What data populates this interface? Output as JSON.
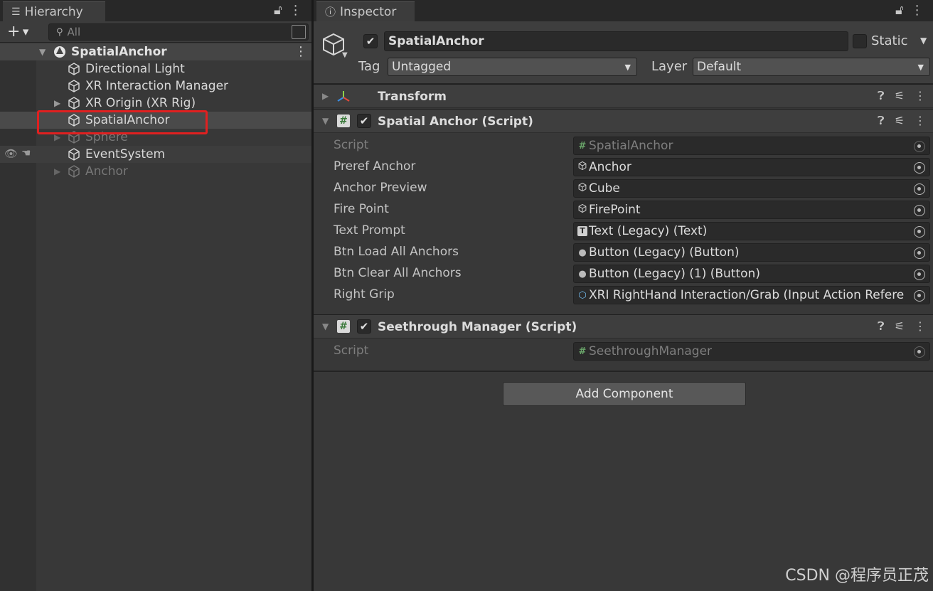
{
  "hierarchy": {
    "tab_label": "Hierarchy",
    "search_placeholder": "All",
    "scene": "SpatialAnchor",
    "items": [
      {
        "label": "Directional Light",
        "dim": false,
        "arrow": false
      },
      {
        "label": "XR Interaction Manager",
        "dim": false,
        "arrow": false
      },
      {
        "label": "XR Origin (XR Rig)",
        "dim": false,
        "arrow": true
      },
      {
        "label": "SpatialAnchor",
        "dim": false,
        "arrow": false,
        "selected": true
      },
      {
        "label": "Sphere",
        "dim": true,
        "arrow": true
      },
      {
        "label": "EventSystem",
        "dim": false,
        "arrow": false
      },
      {
        "label": "Anchor",
        "dim": true,
        "arrow": true
      }
    ]
  },
  "inspector": {
    "tab_label": "Inspector",
    "object_name": "SpatialAnchor",
    "static_label": "Static",
    "tag_label": "Tag",
    "tag_value": "Untagged",
    "layer_label": "Layer",
    "layer_value": "Default",
    "transform_title": "Transform",
    "spatial": {
      "title": "Spatial Anchor (Script)",
      "props": [
        {
          "label": "Script",
          "value": "SpatialAnchor",
          "icon": "script-icon",
          "disabled": true
        },
        {
          "label": "Preref Anchor",
          "value": "Anchor",
          "icon": "cube-icon"
        },
        {
          "label": "Anchor Preview",
          "value": "Cube",
          "icon": "cube-icon"
        },
        {
          "label": "Fire Point",
          "value": "FirePoint",
          "icon": "cube-icon"
        },
        {
          "label": "Text Prompt",
          "value": "Text (Legacy) (Text)",
          "icon": "text-icon"
        },
        {
          "label": "Btn Load All Anchors",
          "value": "Button (Legacy) (Button)",
          "icon": "button-icon"
        },
        {
          "label": "Btn Clear All Anchors",
          "value": "Button (Legacy) (1) (Button)",
          "icon": "button-icon"
        },
        {
          "label": "Right Grip",
          "value": "XRI RightHand Interaction/Grab (Input Action Refere",
          "icon": "input-action-icon"
        }
      ]
    },
    "seethrough": {
      "title": "Seethrough Manager (Script)",
      "props": [
        {
          "label": "Script",
          "value": "SeethroughManager",
          "icon": "script-icon",
          "disabled": true
        }
      ]
    },
    "add_component": "Add Component"
  },
  "watermark": "CSDN @程序员正茂",
  "colors": {
    "selection_outline": "#e02020",
    "panel": "#383838",
    "header": "#3e3e3e"
  }
}
